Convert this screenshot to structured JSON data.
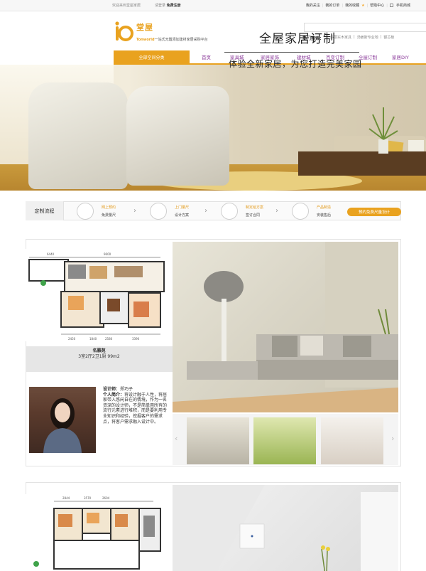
{
  "topbar": {
    "welcome": "欢迎来到堂屋家居",
    "login": "请登录",
    "register": "免费注册",
    "links": [
      "我的关注",
      "我的订单",
      "我的收藏",
      "帮助中心",
      "手机商城"
    ]
  },
  "header": {
    "brand": "堂屋",
    "slogan_en": "Tonworld",
    "slogan_cn": "一站式无醛添加建材家居采购平台",
    "search_label": "热门搜索：",
    "hotwords": [
      "多层实木家具",
      "汤姜斯专业地",
      "额芯板"
    ]
  },
  "nav": {
    "category": "全部空间分类",
    "items": [
      "首页",
      "家具城",
      "家居家饰",
      "建材城",
      "百变订制",
      "全屋订制",
      "家居DIY"
    ]
  },
  "banner": {
    "title": "全屋家居订制",
    "subtitle": "体验全新家居，为您打造完美家园"
  },
  "process": {
    "label": "定制流程",
    "steps": [
      {
        "title": "网上预约",
        "desc": "免费量尺"
      },
      {
        "title": "上门量尺",
        "desc": "设计方案"
      },
      {
        "title": "制定给方案",
        "desc": "签订合同"
      },
      {
        "title": "产品制造",
        "desc": "安装售后"
      }
    ],
    "book_button": "预约免费尺量设计"
  },
  "case1": {
    "name": "名雅苑",
    "spec": "3室2厅2卫1厨 99m2",
    "designer_label": "设计师：",
    "designer_name": "郑巧子",
    "intro_label": "个人简介：",
    "intro": "将设计融于人性，将居家带入悠闲自在的情境，作为一名资深的设计师，不是简单用所有的流行元素进行堆积，而是要利用专业知识和经验，挖掘客户的需求点，将客户需求融入设计中。",
    "plan_dims": [
      "6440",
      "9600",
      "2450",
      "1840",
      "2580",
      "3390"
    ]
  },
  "case2": {
    "plan_dims": [
      "2844",
      "3570",
      "2604"
    ]
  },
  "colors": {
    "accent": "#e9a21f",
    "nav_text": "#8b3a9a"
  }
}
